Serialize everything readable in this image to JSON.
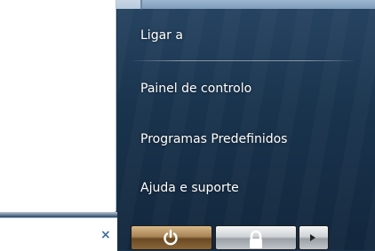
{
  "start_menu": {
    "right_pane": {
      "items": [
        {
          "label": "Ligar a"
        },
        {
          "label": "Painel de controlo"
        },
        {
          "label": "Programas Predefinidos"
        },
        {
          "label": "Ajuda e suporte"
        }
      ]
    },
    "search": {
      "value": "",
      "clear_icon": "close-icon",
      "clear_glyph": "×"
    },
    "bottom_buttons": {
      "power_icon": "power-icon",
      "lock_icon": "lock-icon",
      "more_icon": "arrow-right-icon"
    },
    "colors": {
      "text": "#ffffff",
      "power_button": "#a78356",
      "clear_icon": "#3c6fa3"
    }
  }
}
